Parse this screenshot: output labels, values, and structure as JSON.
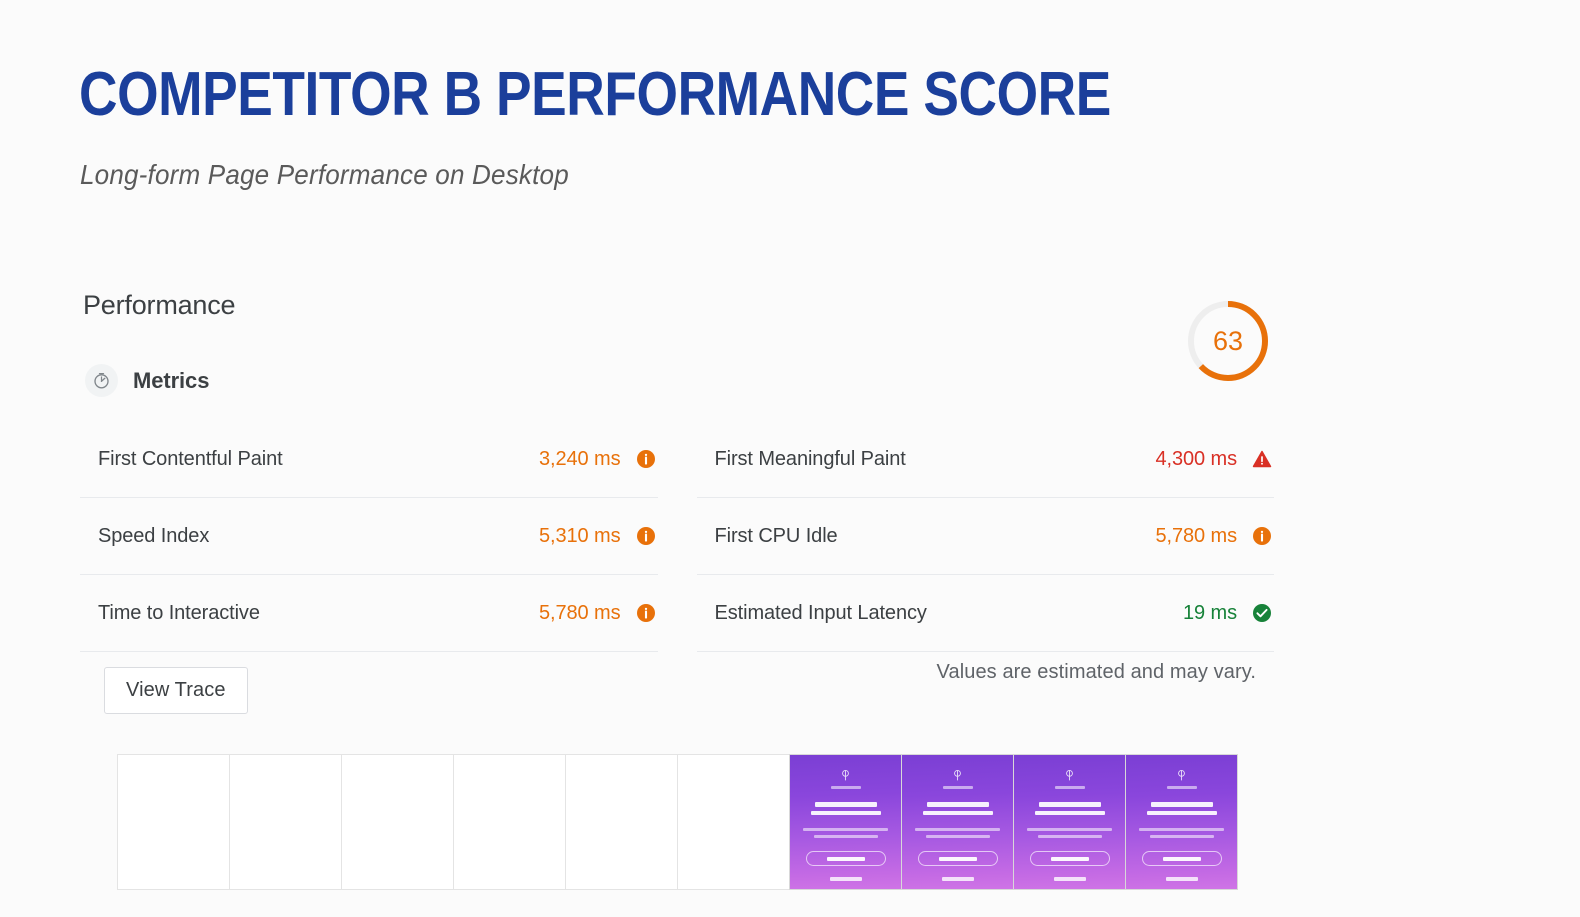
{
  "header": {
    "title": "COMPETITOR B PERFORMANCE SCORE",
    "subtitle": "Long-form Page Performance on Desktop"
  },
  "report": {
    "category_title": "Performance",
    "score": "63",
    "score_value": 63,
    "score_color": "#e8710a",
    "gauge_track_color": "#eeeeee",
    "metrics_section_label": "Metrics",
    "metrics_icon": "stopwatch-icon",
    "view_trace_label": "View Trace",
    "estimated_note": "Values are estimated and may vary.",
    "metrics_left": [
      {
        "label": "First Contentful Paint",
        "value": "3,240 ms",
        "status": "average",
        "icon": "info-circle-icon",
        "color": "#e8710a"
      },
      {
        "label": "Speed Index",
        "value": "5,310 ms",
        "status": "average",
        "icon": "info-circle-icon",
        "color": "#e8710a"
      },
      {
        "label": "Time to Interactive",
        "value": "5,780 ms",
        "status": "average",
        "icon": "info-circle-icon",
        "color": "#e8710a"
      }
    ],
    "metrics_right": [
      {
        "label": "First Meaningful Paint",
        "value": "4,300 ms",
        "status": "fail",
        "icon": "warning-triangle-icon",
        "color": "#d93025"
      },
      {
        "label": "First CPU Idle",
        "value": "5,780 ms",
        "status": "average",
        "icon": "info-circle-icon",
        "color": "#e8710a"
      },
      {
        "label": "Estimated Input Latency",
        "value": "19 ms",
        "status": "pass",
        "icon": "check-circle-icon",
        "color": "#178239"
      }
    ],
    "filmstrip": {
      "frame_count": 10,
      "blank_frames": 6,
      "loaded_frames": 4,
      "loaded_gradient_from": "#7b3fd4",
      "loaded_gradient_to": "#cf74e6"
    }
  }
}
